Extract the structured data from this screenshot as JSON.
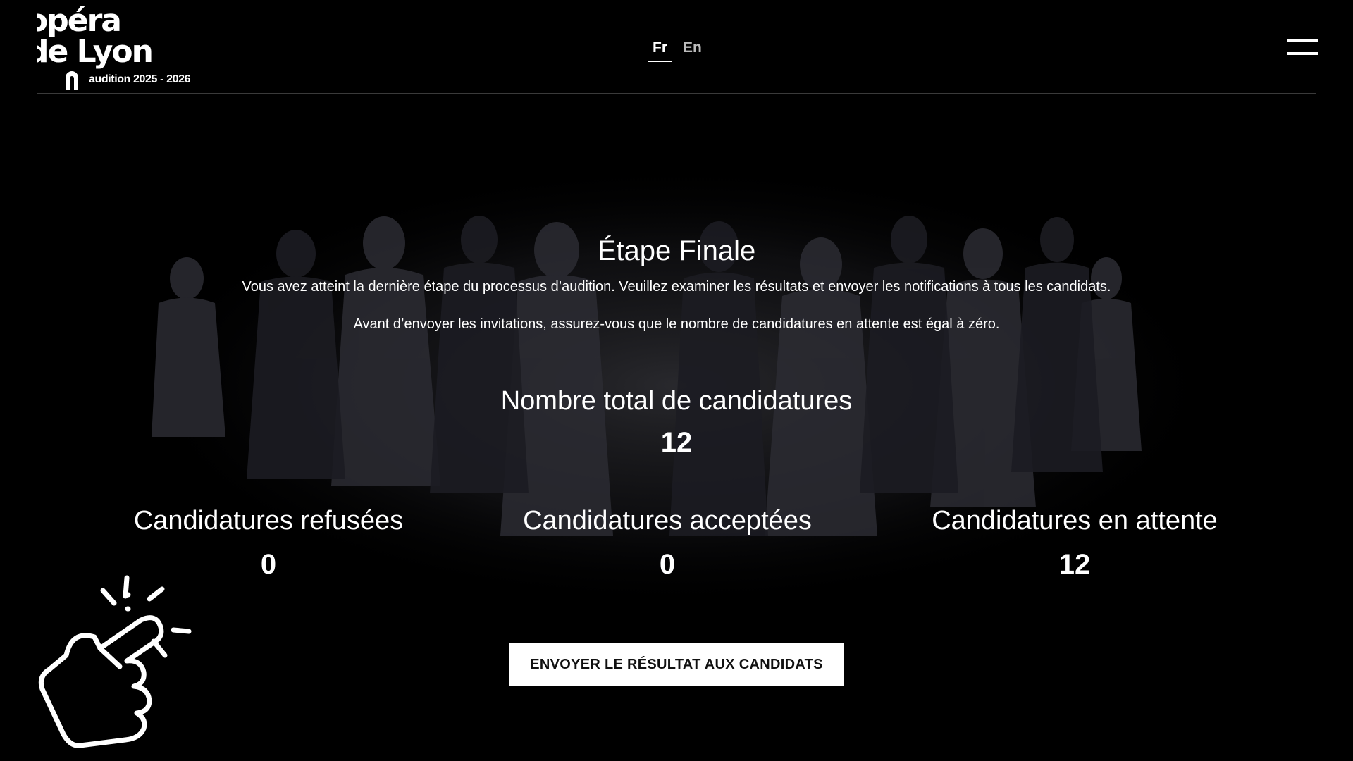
{
  "header": {
    "logo": {
      "line1": "opéra",
      "line2": "de Lyon",
      "subtitle": "audition 2025 - 2026"
    },
    "languages": [
      {
        "label": "Fr",
        "active": true
      },
      {
        "label": "En",
        "active": false
      }
    ],
    "menu_icon": "hamburger-menu-icon"
  },
  "main": {
    "title": "Étape Finale",
    "description_1": "Vous avez atteint la dernière étape du processus d’audition. Veuillez examiner les résultats et envoyer les notifications à tous les candidats.",
    "description_2": "Avant d’envoyer les invitations, assurez-vous que le nombre de candidatures en attente est égal à zéro.",
    "total": {
      "label": "Nombre total de candidatures",
      "value": "12"
    },
    "refused": {
      "label": "Candidatures refusées",
      "value": "0"
    },
    "accepted": {
      "label": "Candidatures acceptées",
      "value": "0"
    },
    "pending": {
      "label": "Candidatures en attente",
      "value": "12"
    },
    "send_button": "ENVOYER LE RÉSULTAT AUX CANDIDATS"
  },
  "overlay": {
    "pointer_icon": "pointing-hand-click-icon"
  },
  "colors": {
    "background": "#000000",
    "text": "#ffffff",
    "button_bg": "#ffffff",
    "button_text": "#111111"
  }
}
